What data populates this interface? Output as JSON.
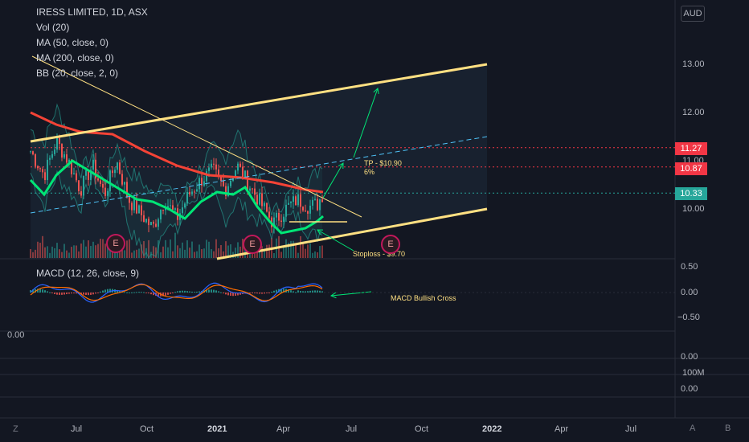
{
  "header": {
    "title": "IRESS LIMITED, 1D, ASX",
    "indicators": [
      "Vol (20)",
      "MA (50, close, 0)",
      "MA (200, close, 0)",
      "BB (20, close, 2, 0)"
    ],
    "macd_label": "MACD (12, 26, close, 9)"
  },
  "currency": "AUD",
  "price_axis": [
    "13.00",
    "12.00",
    "11.00",
    "10.00"
  ],
  "price_tags": [
    {
      "label": "11.27",
      "color": "#f23645"
    },
    {
      "label": "10.87",
      "color": "#f23645"
    },
    {
      "label": "10.33",
      "color": "#26a69a"
    }
  ],
  "macd_axis": [
    "0.50",
    "0.00",
    "−0.50"
  ],
  "lower_axis": [
    "0.00",
    "100M",
    "0.00"
  ],
  "left_label": "0.00",
  "time_axis": [
    "Z",
    "Jul",
    "Oct",
    "2021",
    "Apr",
    "Jul",
    "Oct",
    "2022",
    "Apr",
    "Jul"
  ],
  "bottom_buttons": {
    "auto": "A",
    "log": "B"
  },
  "annotations": {
    "tp": "TP - $10.90",
    "tp_pct": "6%",
    "stoploss": "Stoploss - $9.70",
    "macd": "MACD Bullish Cross"
  },
  "earnings_label": "E",
  "chart_data": {
    "type": "line",
    "title": "IRESS LIMITED, 1D, ASX",
    "ylim": [
      9.0,
      13.5
    ],
    "y_ticks": [
      10.0,
      11.0,
      12.0,
      13.0
    ],
    "x_ticks": [
      "Jul",
      "Oct",
      "2021",
      "Apr",
      "Jul",
      "Oct",
      "2022",
      "Apr",
      "Jul"
    ],
    "reference_levels": [
      11.27,
      10.87,
      10.33
    ],
    "series": [
      {
        "name": "MA (50, close, 0)",
        "color": "#00e676"
      },
      {
        "name": "MA (200, close, 0)",
        "color": "#f44336"
      }
    ],
    "macd_ylim": [
      -0.75,
      0.65
    ],
    "macd_ticks": [
      0.5,
      0.0,
      -0.5
    ],
    "grid": false
  }
}
